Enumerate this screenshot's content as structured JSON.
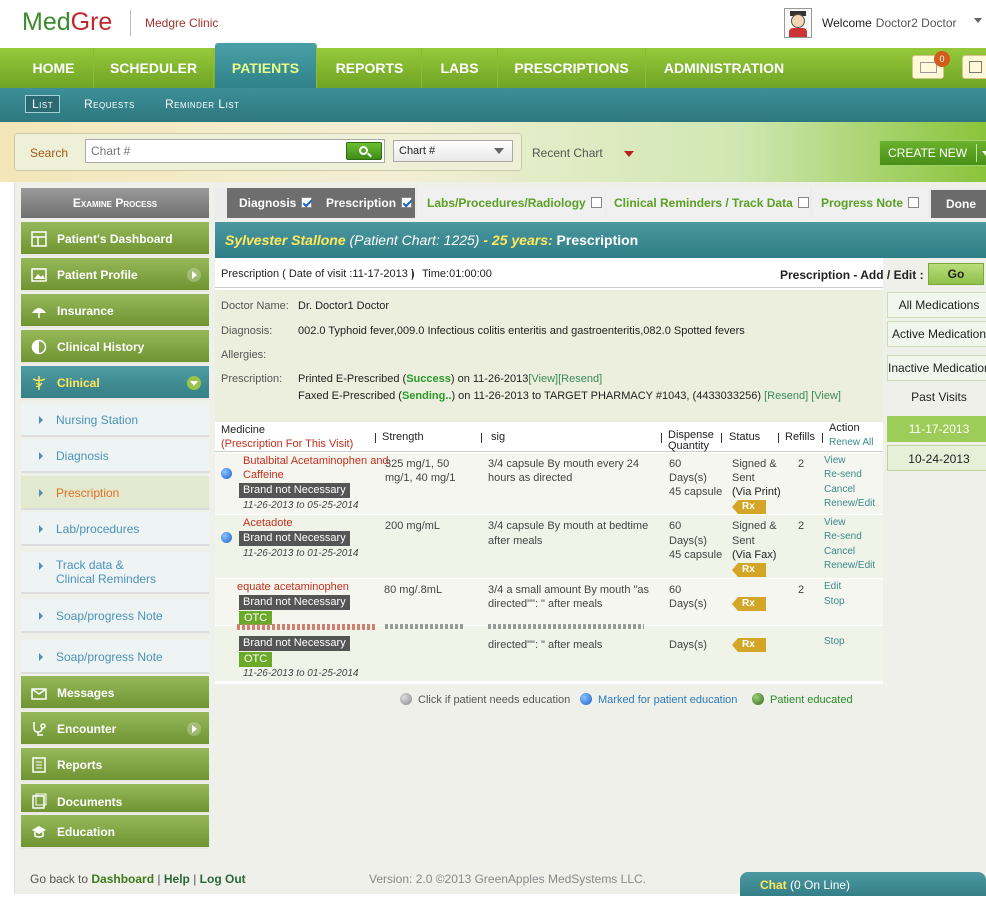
{
  "header": {
    "logo_med": "Med",
    "logo_gre": "Gre",
    "clinic_name": "Medgre Clinic",
    "welcome": "Welcome",
    "user_name": "Doctor2 Doctor"
  },
  "mainnav": {
    "tabs": [
      "HOME",
      "SCHEDULER",
      "PATIENTS",
      "REPORTS",
      "LABS",
      "PRESCRIPTIONS",
      "ADMINISTRATION"
    ],
    "active": "PATIENTS",
    "mail_count": "0"
  },
  "subnav": {
    "items": [
      "List",
      "Requests",
      "Reminder List"
    ]
  },
  "search": {
    "label": "Search",
    "placeholder": "Chart #",
    "select_value": "Chart #",
    "recent_label": "Recent Chart",
    "create_new": "CREATE NEW"
  },
  "sidebar": {
    "title": "Examine Process",
    "items": [
      "Patient's Dashboard",
      "Patient Profile",
      "Insurance",
      "Clinical History",
      "Clinical"
    ],
    "subitems": [
      "Nursing Station",
      "Diagnosis",
      "Prescription",
      "Lab/procedures",
      "Track data &",
      "Clinical Reminders",
      "Soap/progress Note",
      "Soap/progress Note"
    ],
    "items_after": [
      "Messages",
      "Encounter",
      "Reports",
      "Documents",
      "Education"
    ]
  },
  "process_tabs": {
    "tabs": [
      "Diagnosis",
      "Prescription",
      "Labs/Procedures/Radiology",
      "Clinical Reminders / Track Data",
      "Progress Note"
    ],
    "done": "Done"
  },
  "patient": {
    "name": "Sylvester Stallone",
    "chart": "(Patient Chart: 1225)",
    "age": "- 25 years:",
    "section": "Prescription"
  },
  "visit": {
    "text": "Prescription ( Date of visit :11-17-2013 )",
    "sep": "|",
    "time": "Time:01:00:00",
    "add_edit": "Prescription - Add / Edit :",
    "go": "Go"
  },
  "info": {
    "doctor_label": "Doctor Name:",
    "doctor": "Dr. Doctor1 Doctor",
    "diagnosis_label": "Diagnosis:",
    "diagnosis": "002.0 Typhoid fever,009.0 Infectious colitis enteritis and gastroenteritis,082.0 Spotted fevers",
    "allergies_label": "Allergies:",
    "prescription_label": "Prescription:",
    "line1_a": "Printed E-Prescribed (",
    "line1_status": "Success",
    "line1_b": ") on 11-26-2013",
    "line1_links": "[View][Resend]",
    "line2_a": "Faxed E-Prescribed (",
    "line2_status": "Sending..",
    "line2_b": ") on 11-26-2013 to TARGET PHARMACY #1043, (4433033256)",
    "line2_links": "[Resend] [View]"
  },
  "table": {
    "h_medicine": "Medicine",
    "h_medicine_sub": "(Prescription For This Visit)",
    "h_strength": "Strength",
    "h_sig": "sig",
    "h_dispense": "Dispense",
    "h_quantity": "Quantity",
    "h_status": "Status",
    "h_refills": "Refills",
    "h_action": "Action",
    "h_renew": "Renew All",
    "rows": [
      {
        "name1": "Butalbital Acetaminophen and",
        "name2": "Caffeine",
        "brand": "Brand not Necessary",
        "dates": "11-26-2013 to 05-25-2014",
        "strength1": "325    mg/1,    50",
        "strength2": "mg/1, 40 mg/1",
        "sig1": "3/4 capsule By mouth every 24",
        "sig2": "hours as directed",
        "qty1": "60",
        "qty2": "Days(s)",
        "qty3": "45 capsule",
        "status1": "Signed &",
        "status2": "Sent",
        "status3": "(Via Print)",
        "rx": "Rx",
        "refills": "2",
        "a1": "View",
        "a2": "Re-send",
        "a3": "Cancel",
        "a4": "Renew/Edit"
      },
      {
        "name1": "Acetadote",
        "brand": "Brand not Necessary",
        "dates": "11-26-2013 to 01-25-2014",
        "strength1": "200 mg/mL",
        "sig1": "3/4 capsule By mouth at bedtime",
        "sig2": "after meals",
        "qty1": "60",
        "qty2": "Days(s)",
        "qty3": "45 capsule",
        "status1": "Signed &",
        "status2": "Sent",
        "status3": "(Via Fax)",
        "rx": "Rx",
        "refills": "2",
        "a1": "View",
        "a2": "Re-send",
        "a3": "Cancel",
        "a4": "Renew/Edit"
      },
      {
        "name1": "equate acetaminophen",
        "brand": "Brand not Necessary",
        "otc": "OTC",
        "strength1": "80 mg/.8mL",
        "sig1": "3/4 a small amount By mouth \"as",
        "sig2": "directed\"\": \" after meals",
        "qty1": "60",
        "qty2": "Days(s)",
        "rx": "Rx",
        "refills": "2",
        "a1": "Edit",
        "a2": "Stop"
      },
      {
        "brand": "Brand not Necessary",
        "otc": "OTC",
        "dates": "11-26-2013 to 01-25-2014",
        "sig2": "directed\"\": \" after meals",
        "qty2": "Days(s)",
        "rx": "Rx",
        "a1": "Stop"
      }
    ]
  },
  "legend": {
    "l1": "Click if patient needs education",
    "l2": "Marked for patient education",
    "l3": "Patient educated"
  },
  "right_panel": {
    "all": "All Medications",
    "active": "Active Medication",
    "inactive": "Inactive Medication",
    "past_title": "Past Visits",
    "dates": [
      "11-17-2013",
      "10-24-2013"
    ]
  },
  "footer": {
    "goback": "Go back to",
    "dashboard": "Dashboard",
    "help": "Help",
    "logout": "Log Out",
    "version": "Version: 2.0 ©2013 GreenApples MedSystems LLC.",
    "chat": "Chat",
    "online": "(0 On Line)"
  },
  "colors": {
    "nav_green": "#7fb42c",
    "teal": "#357f86",
    "accent_yellow": "#ffe85a",
    "med_red": "#c03020"
  }
}
